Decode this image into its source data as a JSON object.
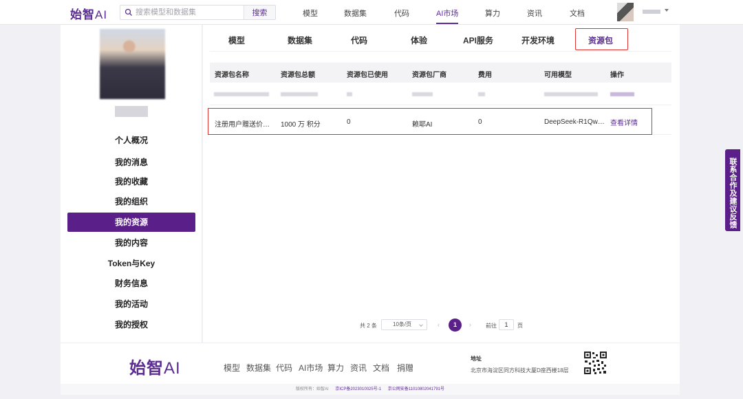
{
  "brand": {
    "logo_main": "始智",
    "logo_ai": "AI"
  },
  "search": {
    "placeholder": "搜索模型和数据集",
    "button": "搜索"
  },
  "nav": {
    "items": [
      "模型",
      "数据集",
      "代码",
      "AI市场",
      "算力",
      "资讯",
      "文档"
    ],
    "active": "AI市场"
  },
  "sidebar": {
    "items": [
      "个人概况",
      "我的消息",
      "我的收藏",
      "我的组织",
      "我的资源",
      "我的内容",
      "Token与Key",
      "财务信息",
      "我的活动",
      "我的授权"
    ],
    "active": "我的资源"
  },
  "tabs": {
    "items": [
      "模型",
      "数据集",
      "代码",
      "体验",
      "API服务",
      "开发环境",
      "资源包"
    ],
    "active": "资源包"
  },
  "table": {
    "headers": [
      "资源包名称",
      "资源包总额",
      "资源包已使用",
      "资源包厂商",
      "费用",
      "可用模型",
      "操作"
    ],
    "row": {
      "name": "注册用户赠送价…",
      "total": "1000 万 积分",
      "used": "0",
      "vendor": "赖耶AI",
      "fee": "0",
      "models": "DeepSeek-R1Qw…",
      "action": "查看详情"
    }
  },
  "pagination": {
    "total": "共 2 条",
    "page_size": "10条/页",
    "prev": "‹",
    "current": "1",
    "next": "›",
    "goto_label": "前往",
    "goto_value": "1",
    "page_label": "页"
  },
  "footer": {
    "logo_main": "始智",
    "logo_ai": "AI",
    "links": [
      "模型",
      "数据集",
      "代码",
      "AI市场",
      "算力",
      "资讯",
      "文档",
      "捐赠"
    ],
    "address_label": "地址",
    "address": "北京市海淀区同方科技大厦D座西楼18层",
    "copyright": "版权所有：始智AI",
    "icp": "京ICP备2023010025号-1",
    "police": "京公网安备11010802041791号"
  },
  "feedback": {
    "label": "联系合作及建议反馈"
  },
  "colors": {
    "accent": "#5b1f8a",
    "highlight": "#e0322c"
  }
}
